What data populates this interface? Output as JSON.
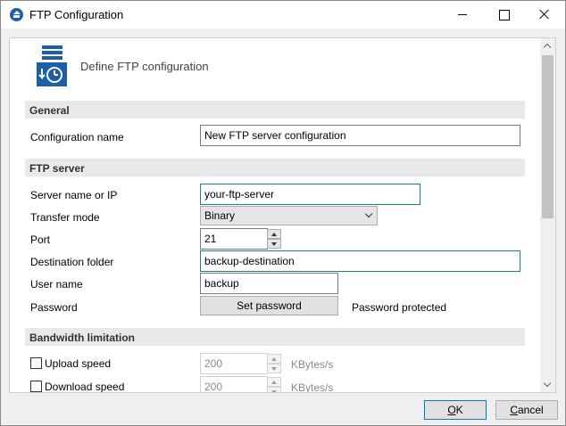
{
  "window": {
    "title": "FTP Configuration"
  },
  "header": {
    "text": "Define FTP configuration"
  },
  "sections": {
    "general": "General",
    "ftp_server": "FTP server",
    "bandwidth": "Bandwidth limitation"
  },
  "general": {
    "config_name_label": "Configuration name",
    "config_name_value": "New FTP server configuration"
  },
  "ftp": {
    "server_label": "Server name or IP",
    "server_value": "your-ftp-server",
    "transfer_mode_label": "Transfer mode",
    "transfer_mode_value": "Binary",
    "port_label": "Port",
    "port_value": "21",
    "dest_folder_label": "Destination folder",
    "dest_folder_value": "backup-destination",
    "username_label": "User name",
    "username_value": "backup",
    "password_label": "Password",
    "set_password_button": "Set password",
    "password_status": "Password protected"
  },
  "bandwidth": {
    "upload_label": "Upload speed",
    "upload_value": "200",
    "upload_unit": "KBytes/s",
    "upload_checked": false,
    "download_label": "Download speed",
    "download_value": "200",
    "download_unit": "KBytes/s",
    "download_checked": false
  },
  "footer": {
    "ok_label": "OK",
    "cancel_label": "Cancel"
  },
  "colors": {
    "accent": "#0078d7",
    "focus_border": "#1e7f8e",
    "icon_blue": "#1b5fa6"
  }
}
